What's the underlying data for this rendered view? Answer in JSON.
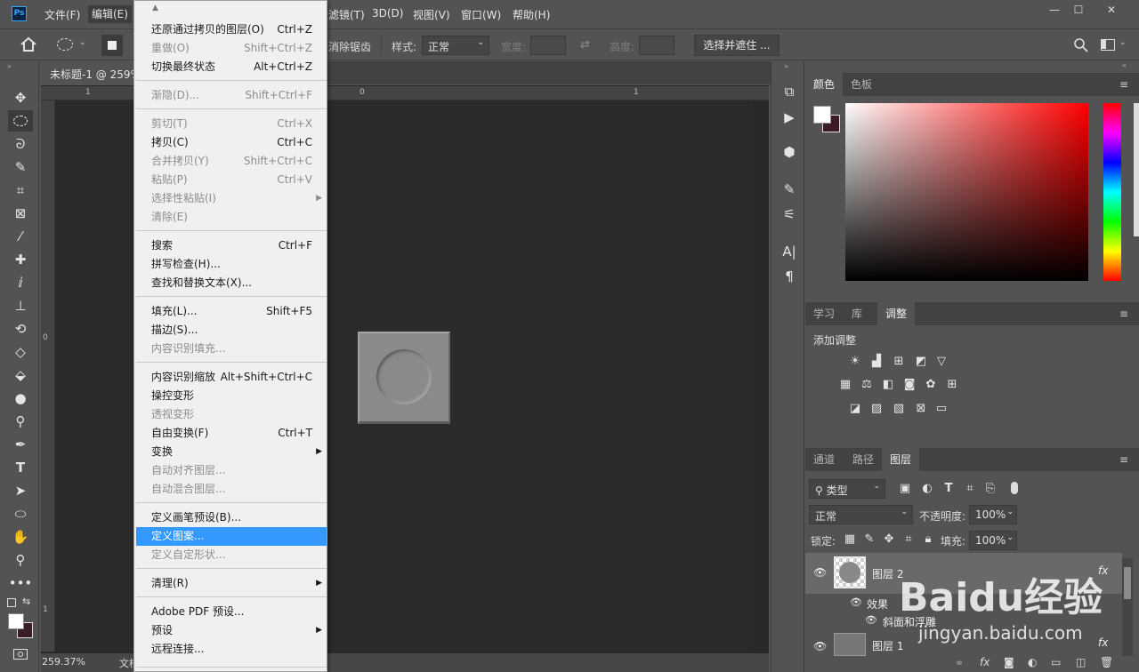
{
  "menubar": {
    "items": [
      "文件(F)",
      "编辑(E)",
      "滤镜(T)",
      "3D(D)",
      "视图(V)",
      "窗口(W)",
      "帮助(H)"
    ],
    "app_icon": "Ps",
    "window_controls": [
      "—",
      "☐",
      "✕"
    ]
  },
  "options_bar": {
    "antialias_label": "消除锯齿",
    "style_label": "样式:",
    "style_value": "正常",
    "width_label": "宽度:",
    "height_label": "高度:",
    "select_mask_label": "选择并遮住 ..."
  },
  "document": {
    "tab_title": "未标题-1 @ 259%",
    "zoom": "259.37%",
    "doc_prefix": "文档",
    "ruler_h": [
      "1",
      "0",
      "1"
    ],
    "ruler_v": [
      "0",
      "1"
    ]
  },
  "edit_menu": {
    "items": [
      {
        "label": "还原通过拷贝的图层(O)",
        "shortcut": "Ctrl+Z",
        "disabled": false
      },
      {
        "label": "重做(O)",
        "shortcut": "Shift+Ctrl+Z",
        "disabled": true
      },
      {
        "label": "切换最终状态",
        "shortcut": "Alt+Ctrl+Z",
        "disabled": false
      },
      {
        "label": "渐隐(D)...",
        "shortcut": "Shift+Ctrl+F",
        "disabled": true
      },
      {
        "label": "剪切(T)",
        "shortcut": "Ctrl+X",
        "disabled": true
      },
      {
        "label": "拷贝(C)",
        "shortcut": "Ctrl+C",
        "disabled": false
      },
      {
        "label": "合并拷贝(Y)",
        "shortcut": "Shift+Ctrl+C",
        "disabled": true
      },
      {
        "label": "粘贴(P)",
        "shortcut": "Ctrl+V",
        "disabled": true
      },
      {
        "label": "选择性粘贴(I)",
        "shortcut": "",
        "disabled": true
      },
      {
        "label": "清除(E)",
        "shortcut": "",
        "disabled": true
      },
      {
        "label": "搜索",
        "shortcut": "Ctrl+F",
        "disabled": false
      },
      {
        "label": "拼写检查(H)...",
        "shortcut": "",
        "disabled": false
      },
      {
        "label": "查找和替换文本(X)...",
        "shortcut": "",
        "disabled": false
      },
      {
        "label": "填充(L)...",
        "shortcut": "Shift+F5",
        "disabled": false
      },
      {
        "label": "描边(S)...",
        "shortcut": "",
        "disabled": false
      },
      {
        "label": "内容识别填充...",
        "shortcut": "",
        "disabled": true
      },
      {
        "label": "内容识别缩放",
        "shortcut": "Alt+Shift+Ctrl+C",
        "disabled": false
      },
      {
        "label": "操控变形",
        "shortcut": "",
        "disabled": false
      },
      {
        "label": "透视变形",
        "shortcut": "",
        "disabled": true
      },
      {
        "label": "自由变换(F)",
        "shortcut": "Ctrl+T",
        "disabled": false
      },
      {
        "label": "变换",
        "shortcut": "",
        "disabled": false
      },
      {
        "label": "自动对齐图层...",
        "shortcut": "",
        "disabled": true
      },
      {
        "label": "自动混合图层...",
        "shortcut": "",
        "disabled": true
      },
      {
        "label": "定义画笔预设(B)...",
        "shortcut": "",
        "disabled": false
      },
      {
        "label": "定义图案...",
        "shortcut": "",
        "disabled": false
      },
      {
        "label": "定义自定形状...",
        "shortcut": "",
        "disabled": true
      },
      {
        "label": "清理(R)",
        "shortcut": "",
        "disabled": false
      },
      {
        "label": "Adobe PDF 预设...",
        "shortcut": "",
        "disabled": false
      },
      {
        "label": "预设",
        "shortcut": "",
        "disabled": false
      },
      {
        "label": "远程连接...",
        "shortcut": "",
        "disabled": false
      }
    ]
  },
  "color_panel": {
    "tabs": [
      "颜色",
      "色板"
    ],
    "foreground": "#ffffff",
    "background": "#3a1b26"
  },
  "adjust_panel": {
    "tabs": [
      "学习",
      "库",
      "调整"
    ],
    "title": "添加调整"
  },
  "layers_panel": {
    "tabs": [
      "通道",
      "路径",
      "图层"
    ],
    "filter_label": "类型",
    "blend_mode": "正常",
    "opacity_label": "不透明度:",
    "opacity_value": "100%",
    "lock_label": "锁定:",
    "fill_label": "填充:",
    "fill_value": "100%",
    "layers": [
      {
        "name": "图层 2",
        "fx": "fx"
      },
      {
        "name": "效果"
      },
      {
        "name": "斜面和浮雕"
      },
      {
        "name": "图层 1",
        "fx": "fx"
      }
    ]
  },
  "watermark": {
    "text": "Baidu经验",
    "url": "jingyan.baidu.com"
  }
}
